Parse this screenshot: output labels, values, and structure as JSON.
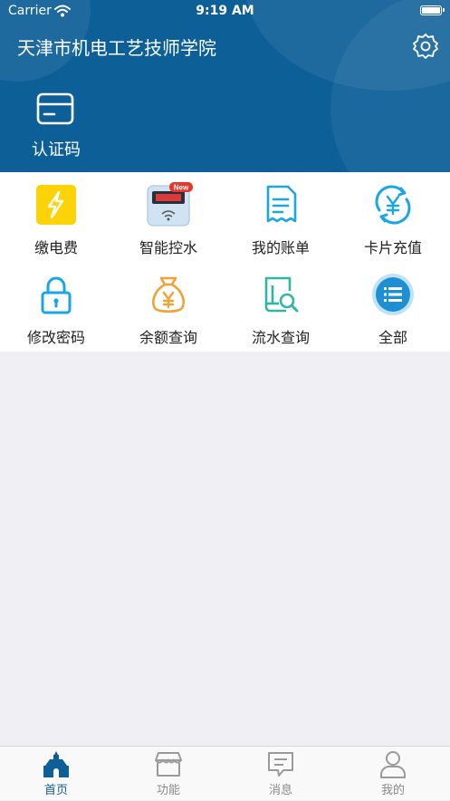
{
  "status_bar": {
    "carrier": "Carrier",
    "time": "9:19 AM"
  },
  "header": {
    "title": "天津市机电工艺技师学院",
    "auth_label": "认证码"
  },
  "functions": [
    {
      "label": "缴电费",
      "icon": "electricity-bill-icon"
    },
    {
      "label": "智能控水",
      "icon": "smart-water-icon",
      "badge": "New"
    },
    {
      "label": "我的账单",
      "icon": "bill-icon"
    },
    {
      "label": "卡片充值",
      "icon": "card-recharge-icon"
    },
    {
      "label": "修改密码",
      "icon": "lock-icon"
    },
    {
      "label": "余额查询",
      "icon": "balance-bag-icon"
    },
    {
      "label": "流水查询",
      "icon": "transaction-search-icon"
    },
    {
      "label": "全部",
      "icon": "all-list-icon"
    }
  ],
  "tabbar": [
    {
      "label": "首页",
      "icon": "home-icon",
      "active": true
    },
    {
      "label": "功能",
      "icon": "store-icon"
    },
    {
      "label": "消息",
      "icon": "message-icon"
    },
    {
      "label": "我的",
      "icon": "person-icon"
    }
  ],
  "colors": {
    "header_bg": "#0d5f98",
    "accent": "#0d5f98",
    "icon_blue": "#1aa6e4",
    "icon_orange": "#f0a335",
    "icon_teal": "#2fb6a4",
    "icon_yellow": "#fcd307",
    "page_bg": "#efeff4"
  }
}
